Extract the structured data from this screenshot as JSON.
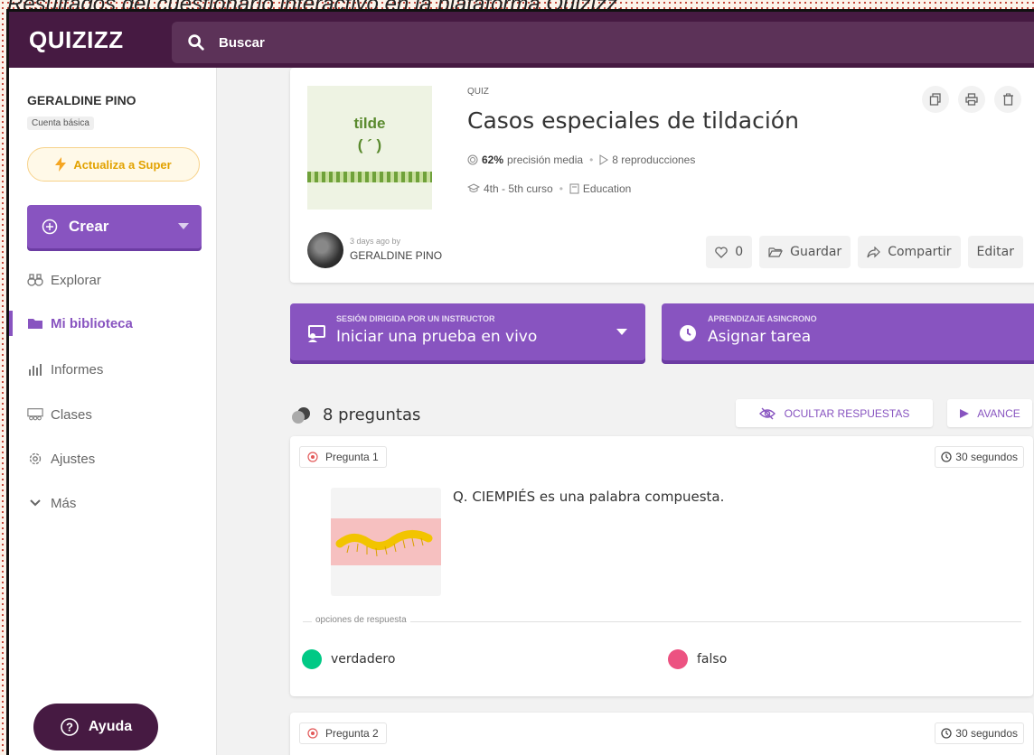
{
  "caption": "Resultados del cuestionario interactivo en la plataforma Quizizz.",
  "header": {
    "logo": "QUIZIZZ",
    "search_label": "Buscar"
  },
  "sidebar": {
    "user_name": "GERALDINE PINO",
    "account_type": "Cuenta básica",
    "upgrade_label": "Actualiza a Super",
    "create_label": "Crear",
    "items": [
      {
        "label": "Explorar",
        "icon": "binoculars-icon"
      },
      {
        "label": "Mi biblioteca",
        "icon": "folder-icon",
        "active": true
      },
      {
        "label": "Informes",
        "icon": "report-icon"
      },
      {
        "label": "Clases",
        "icon": "classes-icon"
      },
      {
        "label": "Ajustes",
        "icon": "gear-icon"
      },
      {
        "label": "Más",
        "icon": "chevron-down-icon"
      }
    ],
    "help_label": "Ayuda"
  },
  "quiz": {
    "thumb_line1": "tilde",
    "thumb_line2": "( ´ )",
    "type": "QUIZ",
    "title": "Casos especiales de tildación",
    "accuracy": "62%",
    "accuracy_label": "precisión media",
    "plays": "8 reproducciones",
    "grade": "4th - 5th curso",
    "subject": "Education",
    "created_when": "3 days ago by",
    "author": "GERALDINE PINO",
    "likes": "0",
    "save_label": "Guardar",
    "share_label": "Compartir",
    "edit_label": "Editar"
  },
  "actions": {
    "live_small": "SESIÓN DIRIGIDA POR UN INSTRUCTOR",
    "live_big": "Iniciar una prueba en vivo",
    "assign_small": "APRENDIZAJE ASINCRONO",
    "assign_big": "Asignar tarea"
  },
  "questions_header": {
    "count": "8 preguntas",
    "hide_label": "OCULTAR RESPUESTAS",
    "preview_label": "AVANCE"
  },
  "question1": {
    "label": "Pregunta 1",
    "time": "30 segundos",
    "text": "Q. CIEMPIÉS es una palabra compuesta.",
    "options_label": "opciones de respuesta",
    "options": [
      {
        "text": "verdadero",
        "color": "#00c985"
      },
      {
        "text": "falso",
        "color": "#ec5281"
      }
    ]
  },
  "question2": {
    "label": "Pregunta 2",
    "time": "30 segundos"
  },
  "colors": {
    "brand_dark": "#461a42",
    "brand_purple": "#8854c0",
    "upgrade_yellow": "#e2a200"
  }
}
